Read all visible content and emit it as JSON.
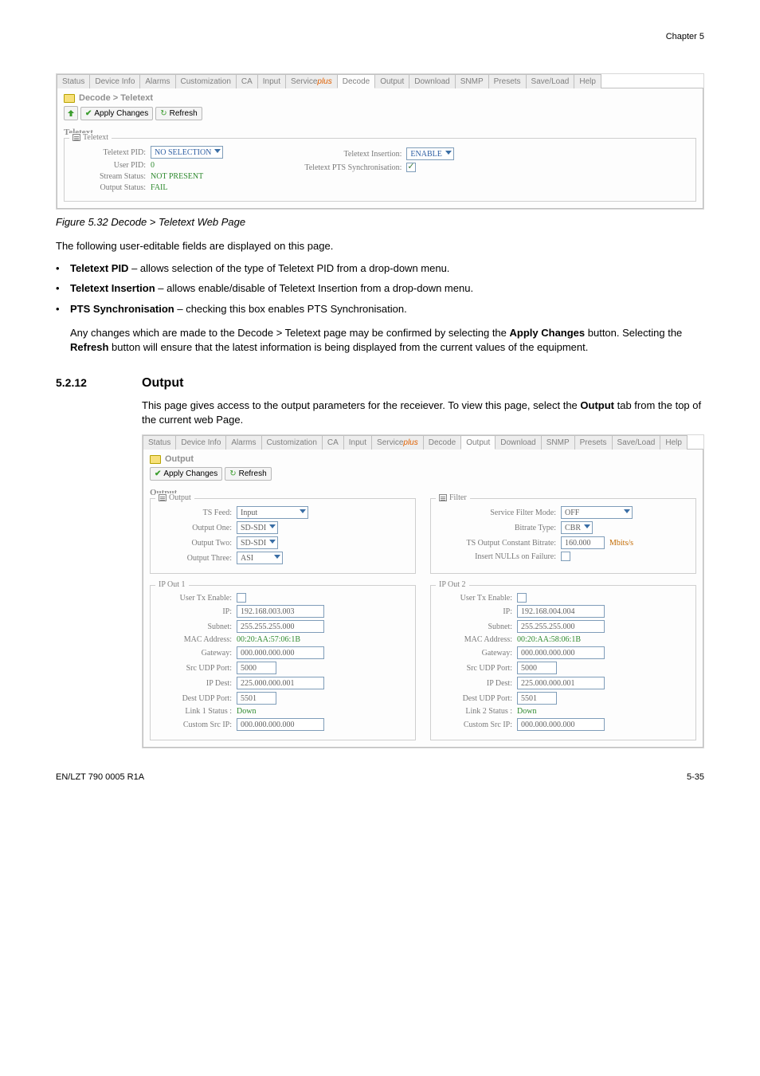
{
  "chapter_header": "Chapter 5",
  "tabs": {
    "status": "Status",
    "device_info": "Device Info",
    "alarms": "Alarms",
    "customization": "Customization",
    "ca": "CA",
    "input": "Input",
    "service": "Service",
    "service_plus": "plus",
    "decode": "Decode",
    "output": "Output",
    "download": "Download",
    "snmp": "SNMP",
    "presets": "Presets",
    "save_load": "Save/Load",
    "help": "Help"
  },
  "fig1": {
    "crumb": "Decode > Teletext",
    "apply": "Apply Changes",
    "refresh": "Refresh",
    "section": "Teletext",
    "legend": "Teletext",
    "rows": {
      "ttx_pid_lbl": "Teletext PID:",
      "ttx_pid_val": "NO SELECTION",
      "user_pid_lbl": "User PID:",
      "user_pid_val": "0",
      "stream_status_lbl": "Stream Status:",
      "stream_status_val": "NOT PRESENT",
      "output_status_lbl": "Output Status:",
      "output_status_val": "FAIL",
      "ttx_ins_lbl": "Teletext Insertion:",
      "ttx_ins_val": "ENABLE",
      "pts_sync_lbl": "Teletext PTS Synchronisation:"
    },
    "caption": "Figure 5.32 Decode > Teletext Web Page"
  },
  "text": {
    "intro1": "The following user-editable fields are displayed on this page.",
    "b1_strong": "Teletext PID",
    "b1_rest": " – allows selection of the type of Teletext PID from a drop-down menu.",
    "b2_strong": "Teletext Insertion",
    "b2_rest": " – allows enable/disable of Teletext Insertion from a drop-down menu.",
    "b3_strong": "PTS Synchronisation",
    "b3_rest": " – checking this box enables PTS Synchronisation.",
    "para2": "Any changes which are made to the Decode > Teletext page may be confirmed by selecting the ",
    "para2_strong1": "Apply Changes",
    "para2_mid": " button. Selecting the ",
    "para2_strong2": "Refresh",
    "para2_end": " button will ensure that the latest information is being displayed from the current values of the equipment."
  },
  "section": {
    "num": "5.2.12",
    "title": "Output"
  },
  "output_intro_a": "This page gives access to the output parameters for the receiever. To view this page, select the ",
  "output_intro_strong": "Output",
  "output_intro_b": " tab from the top of the current web Page.",
  "fig2": {
    "crumb": "Output",
    "apply": "Apply Changes",
    "refresh": "Refresh",
    "section": "Output",
    "output_legend": "Output",
    "filter_legend": "Filter",
    "out": {
      "ts_feed_lbl": "TS Feed:",
      "ts_feed_val": "Input",
      "out_one_lbl": "Output One:",
      "out_one_val": "SD-SDI",
      "out_two_lbl": "Output Two:",
      "out_two_val": "SD-SDI",
      "out_three_lbl": "Output Three:",
      "out_three_val": "ASI"
    },
    "filt": {
      "sfm_lbl": "Service Filter Mode:",
      "sfm_val": "OFF",
      "bt_lbl": "Bitrate Type:",
      "bt_val": "CBR",
      "cbr_lbl": "TS Output Constant Bitrate:",
      "cbr_val": "160.000",
      "cbr_unit": "Mbits/s",
      "null_lbl": "Insert NULLs on Failure:"
    },
    "ip1_legend": "IP Out 1",
    "ip2_legend": "IP Out 2",
    "ip1": {
      "enable_lbl": "User Tx Enable:",
      "ip_lbl": "IP:",
      "ip_val": "192.168.003.003",
      "sub_lbl": "Subnet:",
      "sub_val": "255.255.255.000",
      "mac_lbl": "MAC Address:",
      "mac_val": "00:20:AA:57:06:1B",
      "gw_lbl": "Gateway:",
      "gw_val": "000.000.000.000",
      "src_lbl": "Src UDP Port:",
      "src_val": "5000",
      "ipd_lbl": "IP Dest:",
      "ipd_val": "225.000.000.001",
      "dst_lbl": "Dest UDP Port:",
      "dst_val": "5501",
      "link_lbl": "Link 1 Status :",
      "link_val": "Down",
      "csrc_lbl": "Custom Src IP:",
      "csrc_val": "000.000.000.000"
    },
    "ip2": {
      "enable_lbl": "User Tx Enable:",
      "ip_lbl": "IP:",
      "ip_val": "192.168.004.004",
      "sub_lbl": "Subnet:",
      "sub_val": "255.255.255.000",
      "mac_lbl": "MAC Address:",
      "mac_val": "00:20:AA:58:06:1B",
      "gw_lbl": "Gateway:",
      "gw_val": "000.000.000.000",
      "src_lbl": "Src UDP Port:",
      "src_val": "5000",
      "ipd_lbl": "IP Dest:",
      "ipd_val": "225.000.000.001",
      "dst_lbl": "Dest UDP Port:",
      "dst_val": "5501",
      "link_lbl": "Link 2 Status :",
      "link_val": "Down",
      "csrc_lbl": "Custom Src IP:",
      "csrc_val": "000.000.000.000"
    }
  },
  "footer": {
    "left": "EN/LZT 790 0005 R1A",
    "right": "5-35"
  }
}
